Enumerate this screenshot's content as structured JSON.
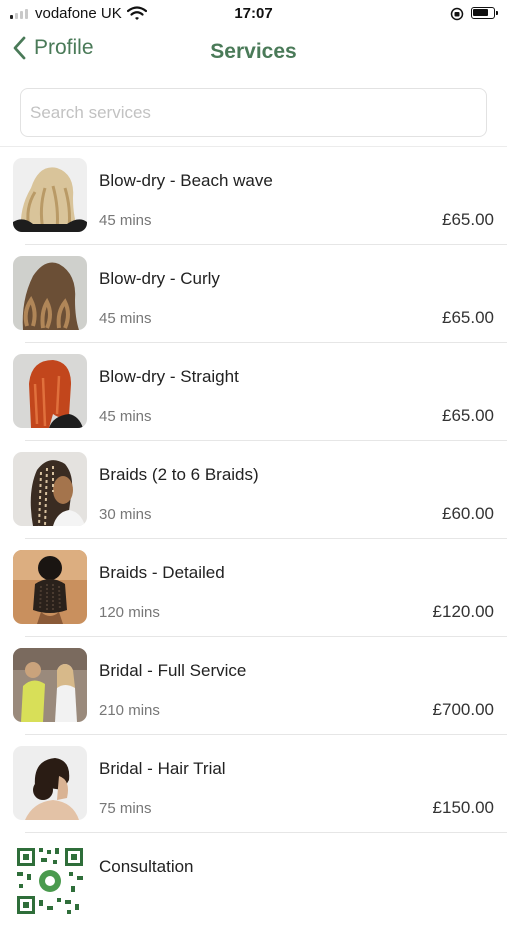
{
  "status_bar": {
    "carrier": "vodafone UK",
    "time": "17:07"
  },
  "nav": {
    "back_label": "Profile",
    "title": "Services"
  },
  "search": {
    "placeholder": "Search services",
    "value": ""
  },
  "colors": {
    "accent": "#4a7a58",
    "text": "#222222",
    "muted": "#777777",
    "separator": "#e6e6e6"
  },
  "services": [
    {
      "name": "Blow-dry - Beach wave",
      "duration": "45 mins",
      "price": "£65.00",
      "thumb_icon": "blonde-waves-photo"
    },
    {
      "name": "Blow-dry - Curly",
      "duration": "45 mins",
      "price": "£65.00",
      "thumb_icon": "brunette-curls-photo"
    },
    {
      "name": "Blow-dry - Straight",
      "duration": "45 mins",
      "price": "£65.00",
      "thumb_icon": "red-straight-hair-photo"
    },
    {
      "name": "Braids (2 to 6 Braids)",
      "duration": "30 mins",
      "price": "£60.00",
      "thumb_icon": "braids-side-photo"
    },
    {
      "name": "Braids - Detailed",
      "duration": "120 mins",
      "price": "£120.00",
      "thumb_icon": "braided-updo-photo"
    },
    {
      "name": "Bridal - Full Service",
      "duration": "210 mins",
      "price": "£700.00",
      "thumb_icon": "bridal-styling-photo"
    },
    {
      "name": "Bridal - Hair Trial",
      "duration": "75 mins",
      "price": "£150.00",
      "thumb_icon": "bridal-bun-photo"
    },
    {
      "name": "Consultation",
      "duration": "",
      "price": "",
      "thumb_icon": "qr-code-icon"
    }
  ]
}
